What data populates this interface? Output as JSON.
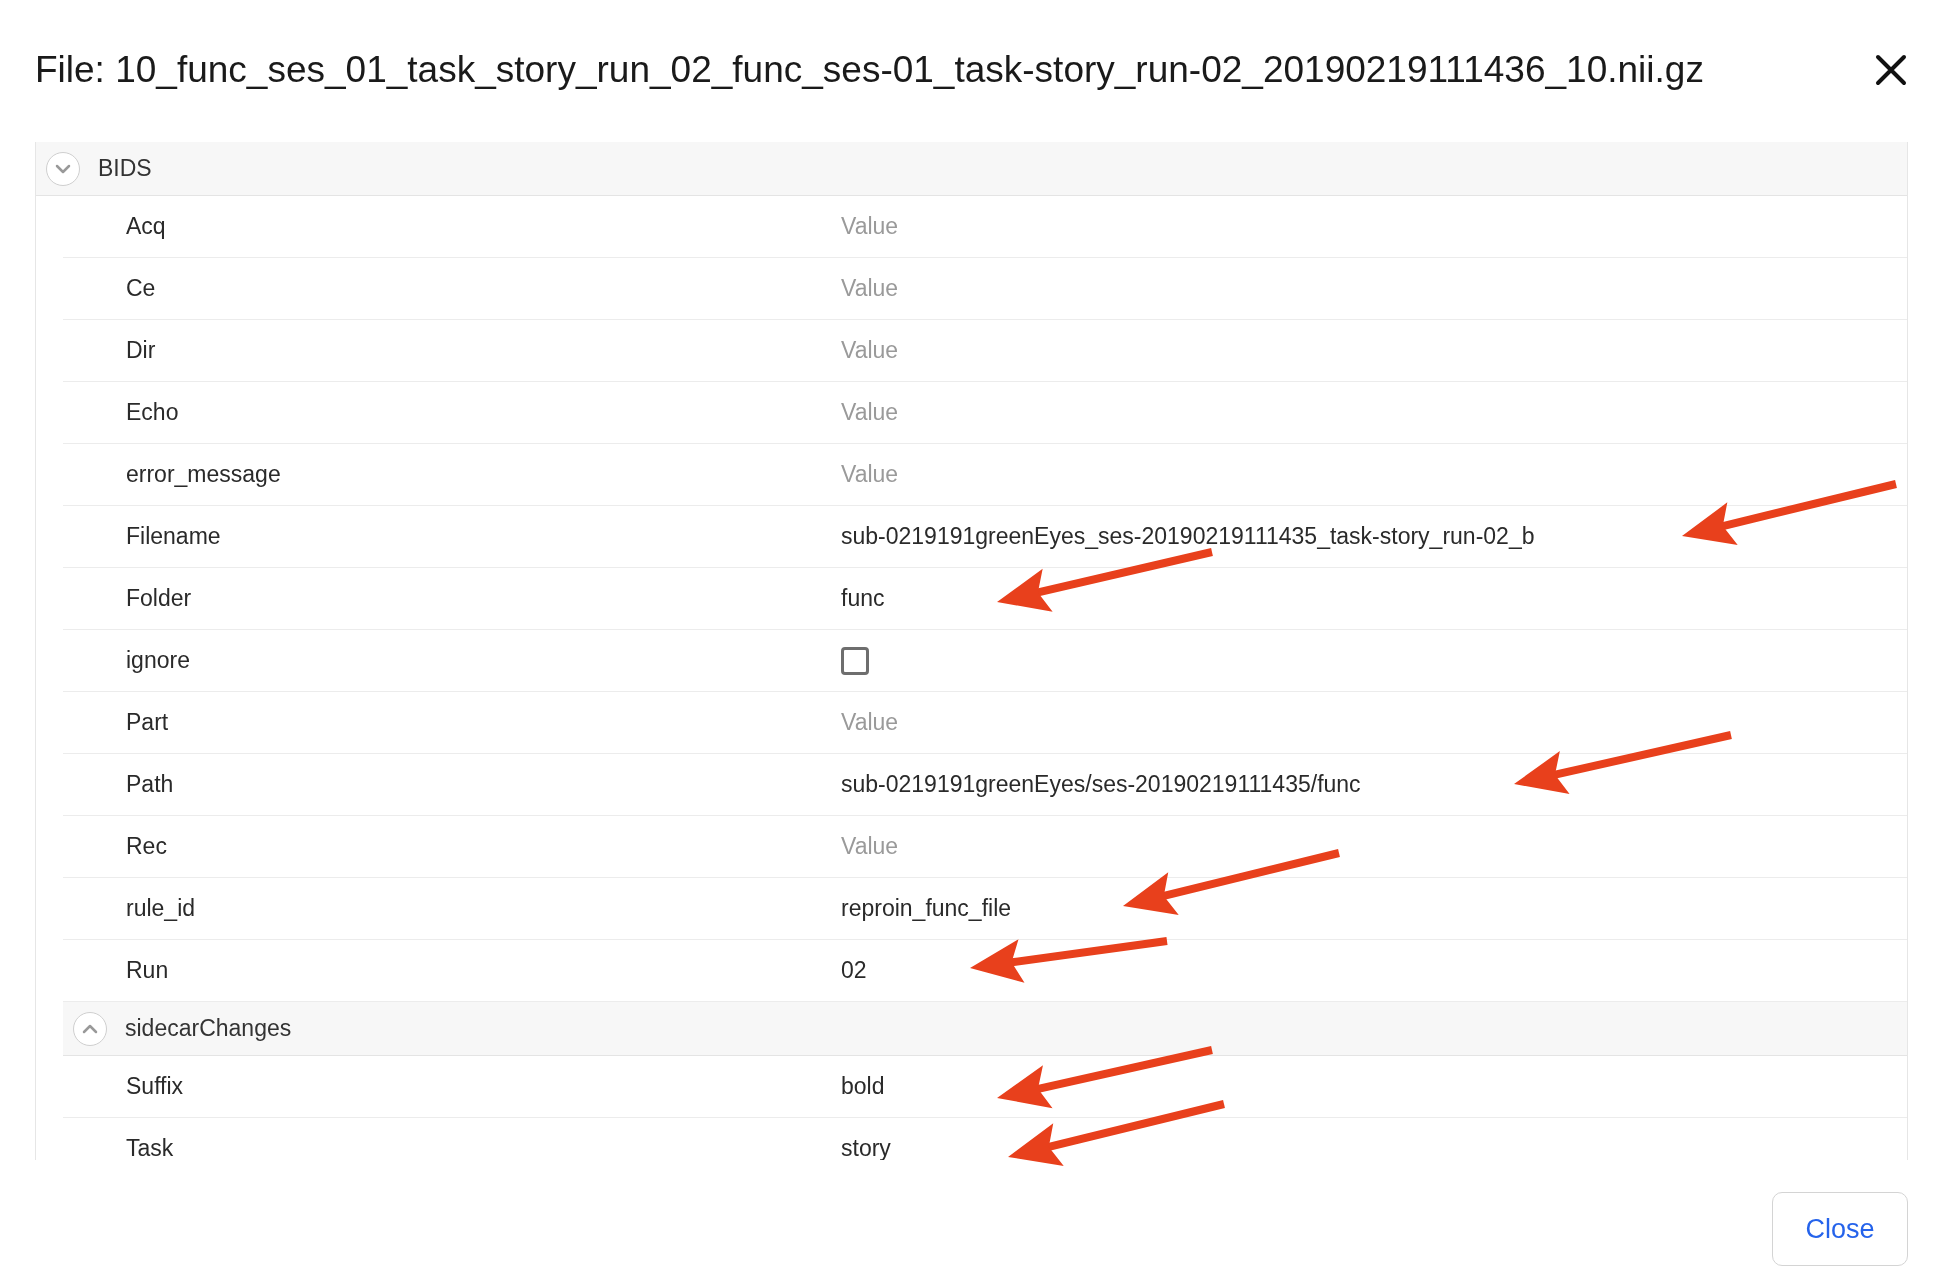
{
  "dialog": {
    "title": "File: 10_func_ses_01_task_story_run_02_func_ses-01_task-story_run-02_20190219111436_10.nii.gz",
    "close_button": "Close"
  },
  "sections": [
    {
      "title": "BIDS",
      "expanded": true,
      "children": [
        {
          "kind": "field",
          "label": "Acq",
          "placeholder": "Value"
        },
        {
          "kind": "field",
          "label": "Ce",
          "placeholder": "Value"
        },
        {
          "kind": "field",
          "label": "Dir",
          "placeholder": "Value"
        },
        {
          "kind": "field",
          "label": "Echo",
          "placeholder": "Value"
        },
        {
          "kind": "field",
          "label": "error_message",
          "placeholder": "Value"
        },
        {
          "kind": "field",
          "label": "Filename",
          "value": "sub-0219191greenEyes_ses-20190219111435_task-story_run-02_b"
        },
        {
          "kind": "field",
          "label": "Folder",
          "value": "func"
        },
        {
          "kind": "checkbox",
          "label": "ignore",
          "checked": false
        },
        {
          "kind": "field",
          "label": "Part",
          "placeholder": "Value"
        },
        {
          "kind": "field",
          "label": "Path",
          "value": "sub-0219191greenEyes/ses-20190219111435/func"
        },
        {
          "kind": "field",
          "label": "Rec",
          "placeholder": "Value"
        },
        {
          "kind": "field",
          "label": "rule_id",
          "value": "reproin_func_file"
        },
        {
          "kind": "field",
          "label": "Run",
          "value": "02"
        },
        {
          "kind": "group",
          "label": "sidecarChanges",
          "expanded": false
        },
        {
          "kind": "field",
          "label": "Suffix",
          "value": "bold"
        },
        {
          "kind": "field",
          "label": "Task",
          "value": "story"
        }
      ]
    }
  ]
}
